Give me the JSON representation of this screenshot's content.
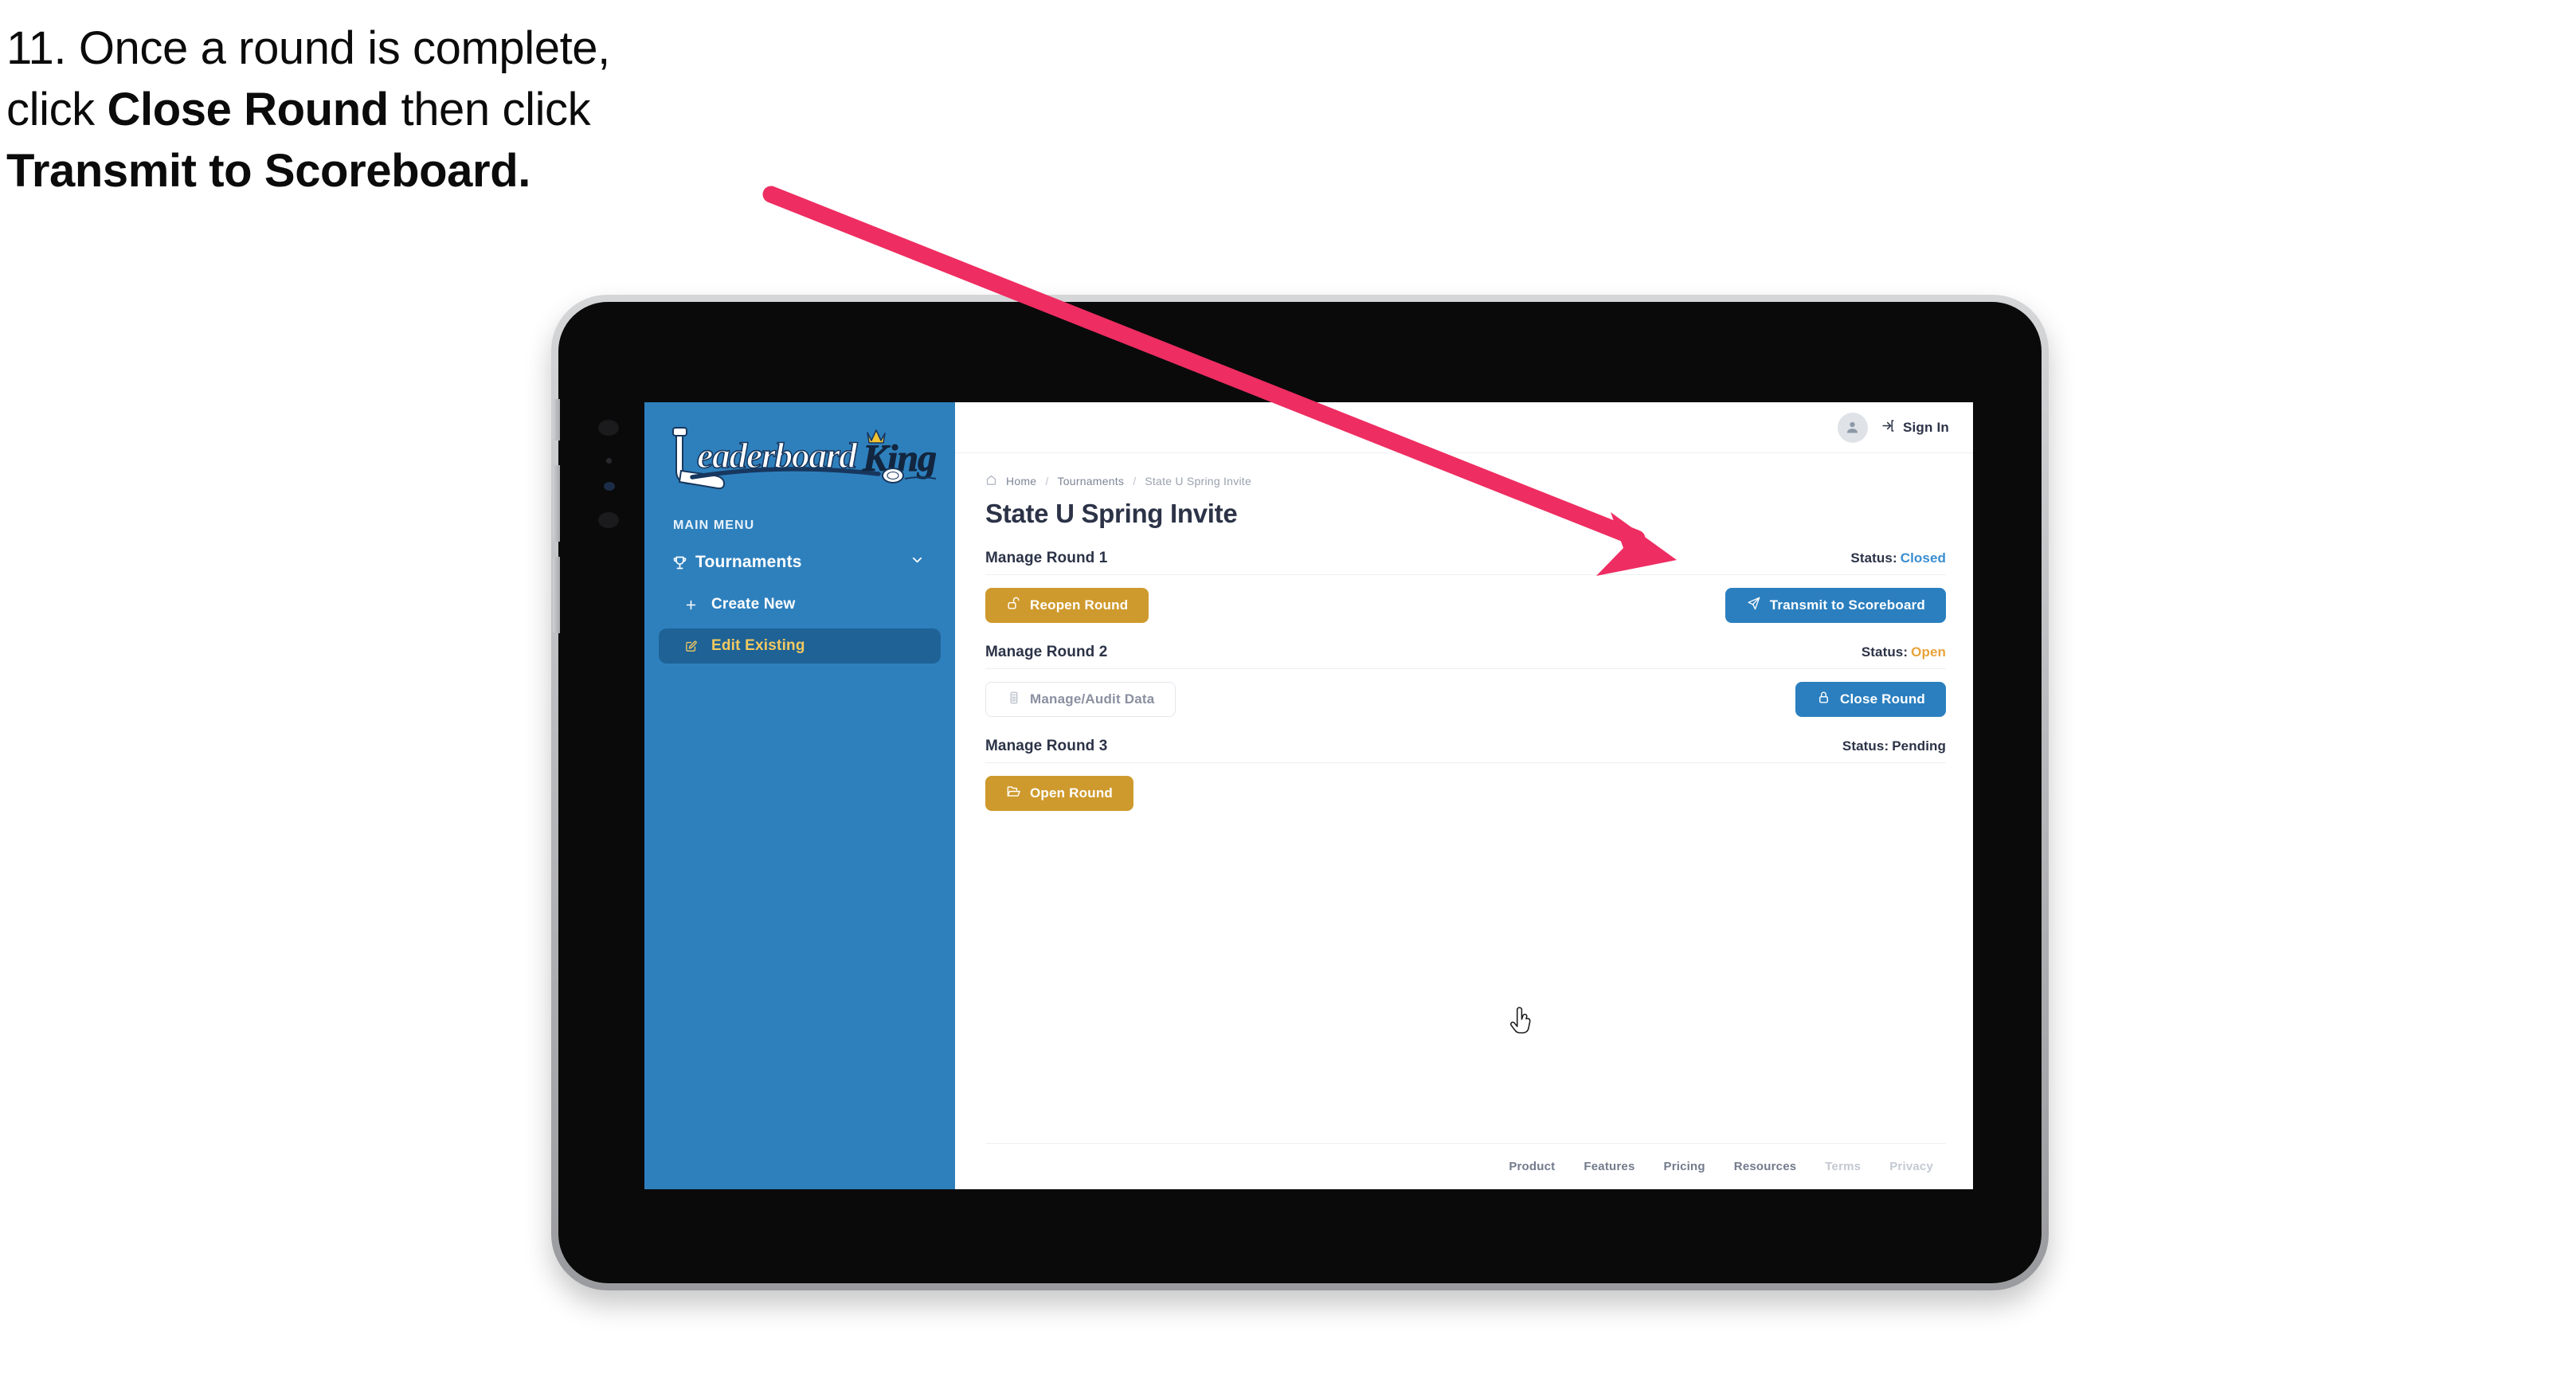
{
  "caption": {
    "number": "11.",
    "line1_pre": "Once a round is complete,",
    "line2_pre": "click ",
    "line2_bold": "Close Round",
    "line2_post": " then click",
    "line3_bold": "Transmit to Scoreboard."
  },
  "annotation": {
    "arrow_color": "#ee2d62"
  },
  "app": {
    "logo_text_main": "Leaderboard",
    "logo_text_accent": "King",
    "brand_blue": "#2e80bd",
    "brand_gold": "#cf9a2d",
    "accent_blue": "#2b7fbf"
  },
  "sidebar": {
    "menu_label": "MAIN MENU",
    "items": [
      {
        "label": "Tournaments",
        "icon": "trophy-icon",
        "expanded": true
      },
      {
        "label": "Create New",
        "icon": "plus-icon",
        "active": false
      },
      {
        "label": "Edit Existing",
        "icon": "pencil-square-icon",
        "active": true
      }
    ]
  },
  "topbar": {
    "avatar_icon": "user-avatar-icon",
    "signin_icon": "sign-in-arrow-icon",
    "signin_label": "Sign In"
  },
  "breadcrumb": {
    "home_icon": "home-icon",
    "items": [
      "Home",
      "Tournaments",
      "State U Spring Invite"
    ],
    "separator": "/"
  },
  "page": {
    "title": "State U Spring Invite"
  },
  "rounds": [
    {
      "name": "Manage Round 1",
      "status_label": "Status:",
      "status_value": "Closed",
      "status_color": "#3a8dd0",
      "left_button": {
        "label": "Reopen Round",
        "icon": "unlock-icon",
        "style": "gold"
      },
      "right_button": {
        "label": "Transmit to Scoreboard",
        "icon": "paper-plane-icon",
        "style": "blue"
      }
    },
    {
      "name": "Manage Round 2",
      "status_label": "Status:",
      "status_value": "Open",
      "status_color": "#e8a33a",
      "left_button": {
        "label": "Manage/Audit Data",
        "icon": "clipboard-icon",
        "style": "ghost"
      },
      "right_button": {
        "label": "Close Round",
        "icon": "lock-icon",
        "style": "blue"
      }
    },
    {
      "name": "Manage Round 3",
      "status_label": "Status:",
      "status_value": "Pending",
      "status_color": "#2c3347",
      "left_button": {
        "label": "Open Round",
        "icon": "open-folder-icon",
        "style": "gold"
      },
      "right_button": null
    }
  ],
  "footer": {
    "links": [
      {
        "label": "Product",
        "dim": false
      },
      {
        "label": "Features",
        "dim": false
      },
      {
        "label": "Pricing",
        "dim": false
      },
      {
        "label": "Resources",
        "dim": false
      },
      {
        "label": "Terms",
        "dim": true
      },
      {
        "label": "Privacy",
        "dim": true
      }
    ]
  },
  "cursor": {
    "type": "pointer-hand-cursor"
  }
}
